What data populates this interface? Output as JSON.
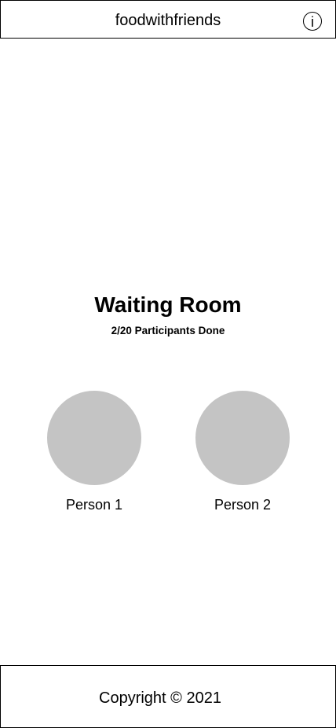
{
  "header": {
    "brand": "foodwithfriends",
    "info_icon_glyph": "i",
    "info_icon": "info-icon"
  },
  "main": {
    "title": "Waiting Room",
    "subtitle": "2/20 Participants Done",
    "participants": [
      {
        "name": "Person 1",
        "avatar_color": "#c4c4c4"
      },
      {
        "name": "Person 2",
        "avatar_color": "#c4c4c4"
      }
    ]
  },
  "footer": {
    "copyright": "Copyright © 2021"
  }
}
